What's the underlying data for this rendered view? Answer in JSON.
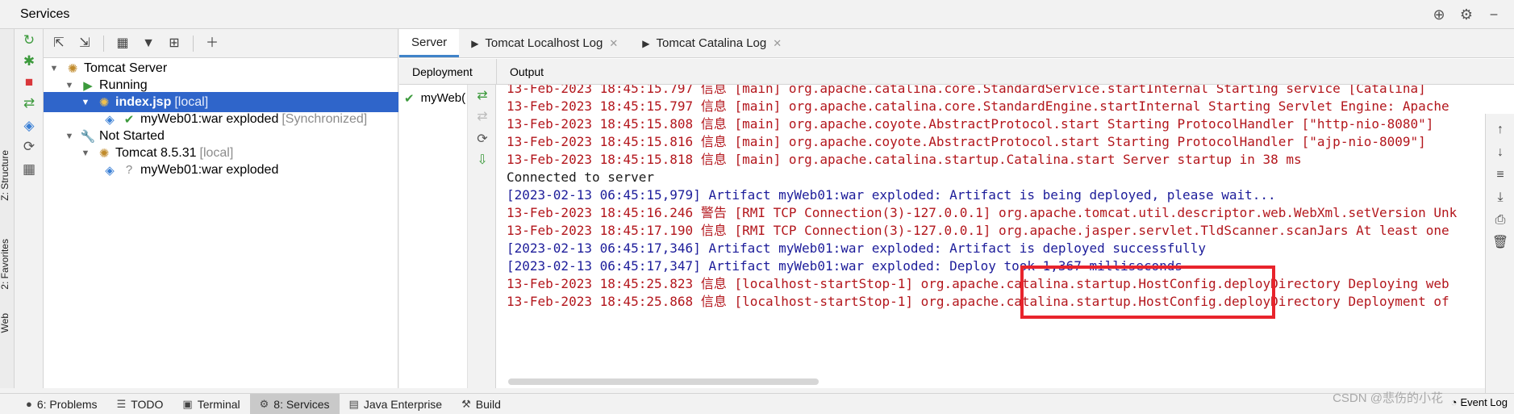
{
  "window": {
    "title": "Services"
  },
  "title_icons": [
    "globe-icon",
    "gear-icon",
    "minimize-icon"
  ],
  "left_strip": {
    "tabs": [
      "Z: Structure",
      "2: Favorites",
      "Web"
    ]
  },
  "tree": {
    "rows": [
      {
        "label": "Tomcat Server",
        "extra": ""
      },
      {
        "label": "Running",
        "extra": ""
      },
      {
        "label": "index.jsp",
        "extra": "[local]"
      },
      {
        "label": "myWeb01:war exploded",
        "extra": "[Synchronized]"
      },
      {
        "label": "Not Started",
        "extra": ""
      },
      {
        "label": "Tomcat 8.5.31",
        "extra": "[local]"
      },
      {
        "label": "myWeb01:war exploded",
        "extra": ""
      }
    ]
  },
  "tabs": [
    {
      "label": "Server"
    },
    {
      "label": "Tomcat Localhost Log"
    },
    {
      "label": "Tomcat Catalina Log"
    }
  ],
  "subheader": {
    "deployment": "Deployment",
    "output": "Output"
  },
  "deployment": {
    "item": "myWeb("
  },
  "console_lines": [
    "13-Feb-2023 18:45:15.797 信息 [main] org.apache.catalina.core.StandardService.startInternal Starting service [Catalina]",
    "13-Feb-2023 18:45:15.797 信息 [main] org.apache.catalina.core.StandardEngine.startInternal Starting Servlet Engine: Apache",
    "13-Feb-2023 18:45:15.808 信息 [main] org.apache.coyote.AbstractProtocol.start Starting ProtocolHandler [\"http-nio-8080\"]",
    "13-Feb-2023 18:45:15.816 信息 [main] org.apache.coyote.AbstractProtocol.start Starting ProtocolHandler [\"ajp-nio-8009\"]",
    "13-Feb-2023 18:45:15.818 信息 [main] org.apache.catalina.startup.Catalina.start Server startup in 38 ms",
    "Connected to server",
    "[2023-02-13 06:45:15,979] Artifact myWeb01:war exploded: Artifact is being deployed, please wait...",
    "13-Feb-2023 18:45:16.246 警告 [RMI TCP Connection(3)-127.0.0.1] org.apache.tomcat.util.descriptor.web.WebXml.setVersion Unk",
    "13-Feb-2023 18:45:17.190 信息 [RMI TCP Connection(3)-127.0.0.1] org.apache.jasper.servlet.TldScanner.scanJars At least one",
    "[2023-02-13 06:45:17,346] Artifact myWeb01:war exploded: Artifact is deployed successfully",
    "[2023-02-13 06:45:17,347] Artifact myWeb01:war exploded: Deploy took 1,367 milliseconds",
    "13-Feb-2023 18:45:25.823 信息 [localhost-startStop-1] org.apache.catalina.startup.HostConfig.deployDirectory Deploying web",
    "13-Feb-2023 18:45:25.868 信息 [localhost-startStop-1] org.apache.catalina.startup.HostConfig.deployDirectory Deployment of"
  ],
  "status_bar": [
    {
      "label": "6: Problems"
    },
    {
      "label": "TODO"
    },
    {
      "label": "Terminal"
    },
    {
      "label": "8: Services"
    },
    {
      "label": "Java Enterprise"
    },
    {
      "label": "Build"
    }
  ],
  "event_log": "Event Log",
  "watermark": "CSDN @悲伤的小花",
  "colors": {
    "selection": "#2f65ca",
    "console_red": "#b3161c",
    "console_blue": "#1c1c9a",
    "highlight_box": "#e8242c",
    "running_green": "#3c9a3c"
  }
}
